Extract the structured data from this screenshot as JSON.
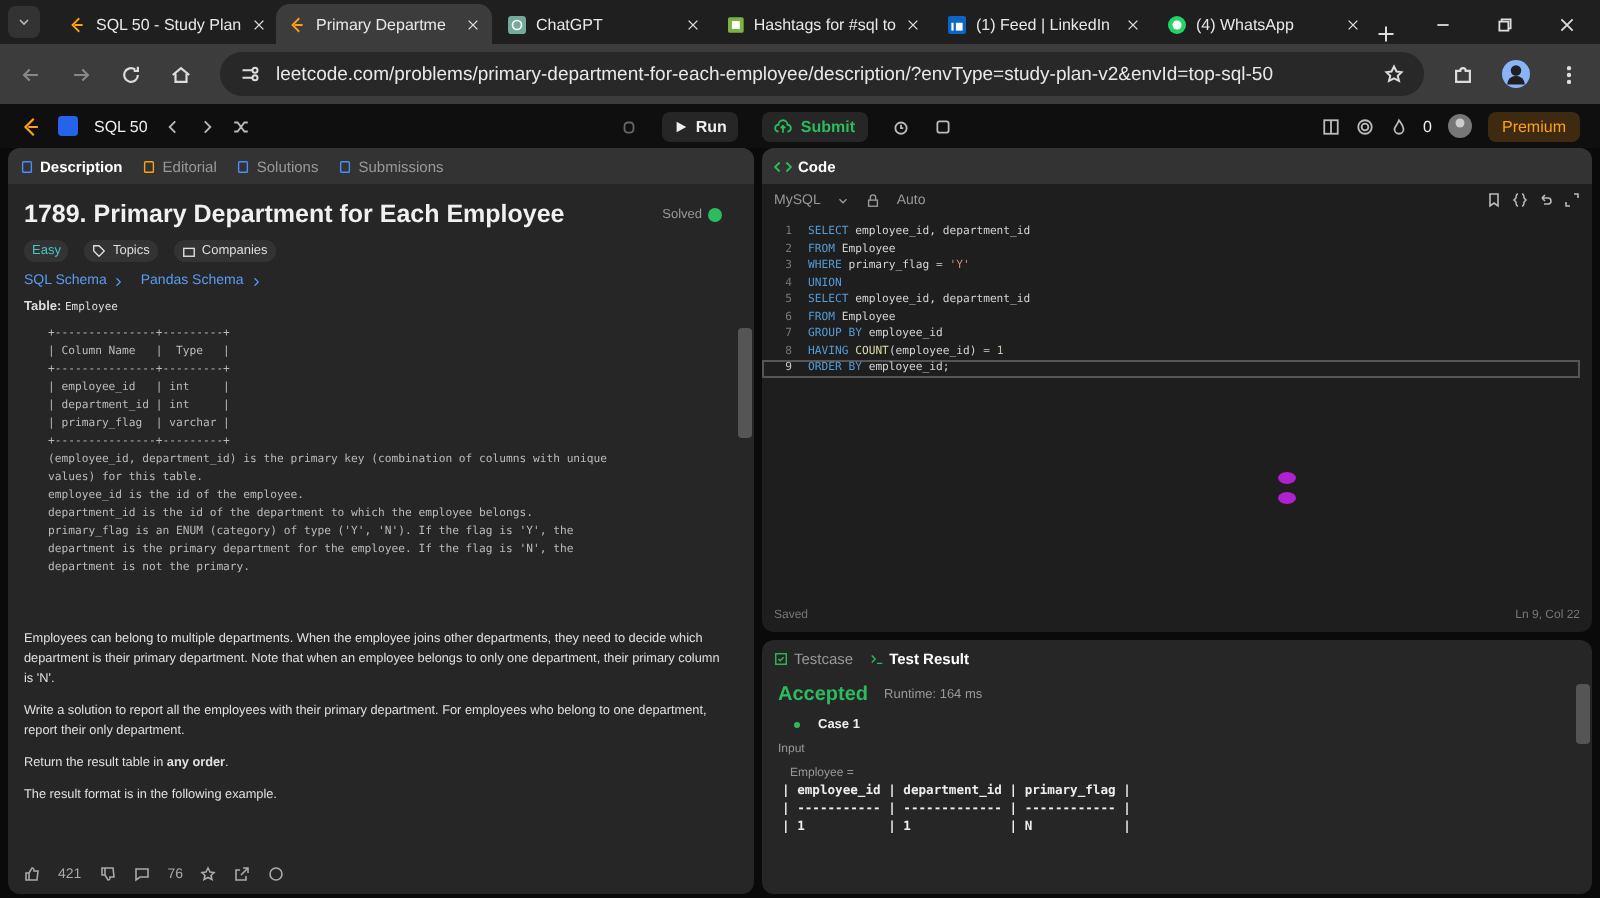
{
  "browser": {
    "tabs": [
      {
        "title": "SQL 50 - Study Plan",
        "selected": false
      },
      {
        "title": "Primary Departme",
        "selected": true
      },
      {
        "title": "ChatGPT",
        "selected": false
      },
      {
        "title": "Hashtags for #sql to",
        "selected": false
      },
      {
        "title": "(1) Feed | LinkedIn",
        "selected": false
      },
      {
        "title": "(4) WhatsApp",
        "selected": false
      }
    ],
    "url": "leetcode.com/problems/primary-department-for-each-employee/description/?envType=study-plan-v2&envId=top-sql-50"
  },
  "topbar": {
    "list_name": "SQL 50",
    "run": "Run",
    "submit": "Submit",
    "streak": "0",
    "premium": "Premium"
  },
  "left_tabs": [
    {
      "label": "Description",
      "selected": true
    },
    {
      "label": "Editorial",
      "selected": false
    },
    {
      "label": "Solutions",
      "selected": false
    },
    {
      "label": "Submissions",
      "selected": false
    }
  ],
  "problem": {
    "title": "1789. Primary Department for Each Employee",
    "status": "Solved",
    "difficulty": "Easy",
    "topics": "Topics",
    "companies": "Companies",
    "schema_links": [
      "SQL Schema",
      "Pandas Schema"
    ],
    "table_label": "Table: ",
    "table_name": "Employee",
    "schema_table": "+---------------+---------+\n| Column Name   |  Type   |\n+---------------+---------+\n| employee_id   | int     |\n| department_id | int     |\n| primary_flag  | varchar |\n+---------------+---------+",
    "schema_notes": "(employee_id, department_id) is the primary key (combination of columns with unique\nvalues) for this table.\nemployee_id is the id of the employee.\ndepartment_id is the id of the department to which the employee belongs.\nprimary_flag is an ENUM (category) of type ('Y', 'N'). If the flag is 'Y', the\ndepartment is the primary department for the employee. If the flag is 'N', the\ndepartment is not the primary.",
    "paragraphs": [
      "Employees can belong to multiple departments. When the employee joins other departments, they need to decide which department is their primary department. Note that when an employee belongs to only one department, their primary column is 'N'.",
      "Write a solution to report all the employees with their primary department. For employees who belong to one department, report their only department.",
      "Return the result table in **any order**.",
      "The result format is in the following example."
    ],
    "likes": "421",
    "comments": "76"
  },
  "code_panel": {
    "title": "Code",
    "language": "MySQL",
    "mode": "Auto",
    "status": "Saved",
    "cursor": "Ln 9, Col 22",
    "lines": [
      {
        "number": "1",
        "current": false,
        "tokens": [
          {
            "text": "SELECT",
            "kind": "keyword"
          },
          {
            "text": " employee_id, department_id",
            "kind": "plain"
          }
        ]
      },
      {
        "number": "2",
        "current": false,
        "tokens": [
          {
            "text": "FROM",
            "kind": "keyword"
          },
          {
            "text": " Employee",
            "kind": "plain"
          }
        ]
      },
      {
        "number": "3",
        "current": false,
        "tokens": [
          {
            "text": "WHERE",
            "kind": "keyword"
          },
          {
            "text": " primary_flag = ",
            "kind": "plain"
          },
          {
            "text": "'Y'",
            "kind": "string"
          }
        ]
      },
      {
        "number": "4",
        "current": false,
        "tokens": [
          {
            "text": "UNION",
            "kind": "keyword"
          }
        ]
      },
      {
        "number": "5",
        "current": false,
        "tokens": [
          {
            "text": "SELECT",
            "kind": "keyword"
          },
          {
            "text": " employee_id, department_id",
            "kind": "plain"
          }
        ]
      },
      {
        "number": "6",
        "current": false,
        "tokens": [
          {
            "text": "FROM",
            "kind": "keyword"
          },
          {
            "text": " Employee",
            "kind": "plain"
          }
        ]
      },
      {
        "number": "7",
        "current": false,
        "tokens": [
          {
            "text": "GROUP BY",
            "kind": "keyword"
          },
          {
            "text": " employee_id",
            "kind": "plain"
          }
        ]
      },
      {
        "number": "8",
        "current": false,
        "tokens": [
          {
            "text": "HAVING",
            "kind": "keyword"
          },
          {
            "text": " COUNT",
            "kind": "function"
          },
          {
            "text": "(employee_id) = ",
            "kind": "plain"
          },
          {
            "text": "1",
            "kind": "number"
          }
        ]
      },
      {
        "number": "9",
        "current": true,
        "tokens": [
          {
            "text": "ORDER BY",
            "kind": "keyword"
          },
          {
            "text": " employee_id;",
            "kind": "plain"
          }
        ]
      }
    ]
  },
  "result_panel": {
    "tabs": [
      {
        "label": "Testcase",
        "selected": false
      },
      {
        "label": "Test Result",
        "selected": true
      }
    ],
    "verdict": "Accepted",
    "runtime": "Runtime: 164 ms",
    "case": "Case 1",
    "input_label": "Input",
    "table_label": "Employee =",
    "table": "| employee_id | department_id | primary_flag |\n| ----------- | ------------- | ------------ |\n| 1           | 1             | N            |"
  }
}
